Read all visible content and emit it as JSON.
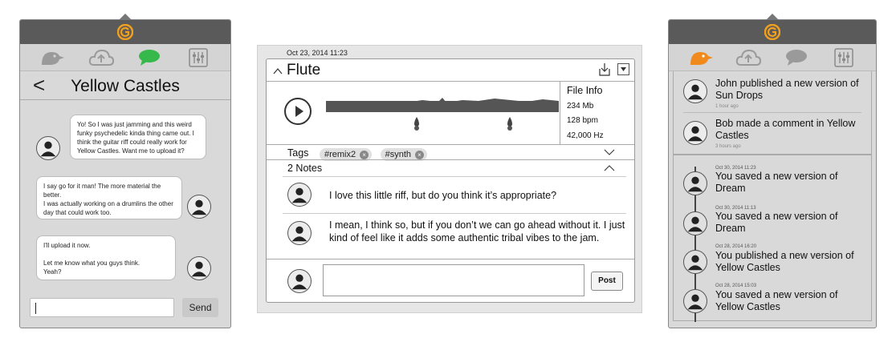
{
  "left_panel": {
    "chat_title": "Yellow Castles",
    "back_glyph": "<",
    "messages": [
      {
        "text": "Yo! So I was just jamming and this weird funky psychedelic kinda thing came out. I think the guitar riff could really work for Yellow Castles. Want me to upload it?"
      },
      {
        "text": "I say go for it man! The more material the better.\nI was actually working on a drumlins the other day that could work too."
      },
      {
        "text": "I'll upload it now.\n\nLet me know what you guys think.\nYeah?"
      }
    ],
    "send_label": "Send",
    "icons": [
      "bird-icon",
      "cloud-upload-icon",
      "chat-bubble-icon",
      "mixer-sliders-icon"
    ],
    "accent_color": "#37b84b"
  },
  "center_panel": {
    "timestamp": "Oct 23, 2014  11:23",
    "track_name": "Flute",
    "file_info_title": "File Info",
    "file_size": "234 Mb",
    "tempo": "128 bpm",
    "sample_rate": "42,000 Hz",
    "tags_label": "Tags",
    "tags": [
      "#remix2",
      "#synth"
    ],
    "notes_label": "2 Notes",
    "notes": [
      {
        "text": "I love this little riff, but do you think it’s appropriate?"
      },
      {
        "text": "I mean, I think so, but if you don’t we can go ahead without it. I just kind of feel like it adds some authentic tribal vibes to the jam."
      }
    ],
    "post_label": "Post"
  },
  "right_panel": {
    "notifications": [
      {
        "text": "John published a new version of Sun Drops",
        "ago": "1 hour ago"
      },
      {
        "text": "Bob made a comment in Yellow Castles",
        "ago": "3 hours ago"
      }
    ],
    "history": [
      {
        "date": "Oct 30, 2014 11:23",
        "text": "You saved a new version of Dream"
      },
      {
        "date": "Oct 30, 2014 11:13",
        "text": "You saved a new version of Dream"
      },
      {
        "date": "Oct 28, 2014 16:20",
        "text": "You published a new version of Yellow Castles"
      },
      {
        "date": "Oct 28, 2014 15:03",
        "text": "You saved a new version of Yellow Castles"
      }
    ],
    "accent_color": "#f08a1c"
  },
  "logo_color": "#f0a020"
}
